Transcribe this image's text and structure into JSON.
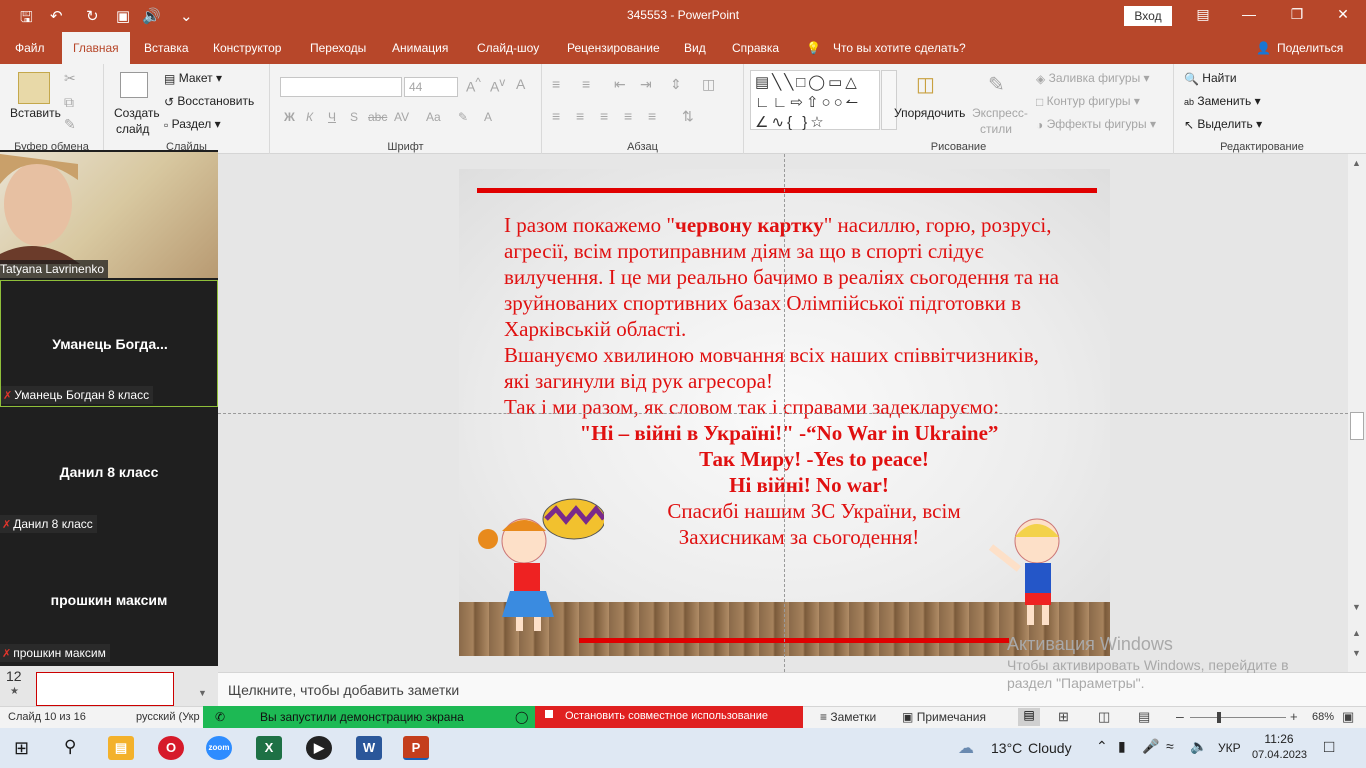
{
  "window": {
    "title": "345553  -  PowerPoint",
    "signin": "Вход"
  },
  "tabs": [
    "Файл",
    "Главная",
    "Вставка",
    "Конструктор",
    "Переходы",
    "Анимация",
    "Слайд-шоу",
    "Рецензирование",
    "Вид",
    "Справка"
  ],
  "tell_me": "Что вы хотите сделать?",
  "share_label": "Поделиться",
  "ribbon": {
    "clipboard": {
      "paste": "Вставить",
      "group": "Буфер обмена"
    },
    "slides": {
      "new_slide_1": "Создать",
      "new_slide_2": "слайд",
      "layout": "Макет",
      "reset": "Восстановить",
      "section": "Раздел",
      "group": "Слайды"
    },
    "font": {
      "size": "44",
      "group": "Шрифт",
      "b": "Ж",
      "i": "К",
      "u": "Ч",
      "s": "S",
      "abc": "abc",
      "av": "AV",
      "aa": "Aa",
      "a": "A"
    },
    "paragraph": {
      "group": "Абзац"
    },
    "drawing": {
      "arrange_1": "Упорядочить",
      "styles_1": "Экспресс-",
      "styles_2": "стили",
      "fill": "Заливка фигуры",
      "outline": "Контур фигуры",
      "effects": "Эффекты фигуры",
      "group": "Рисование"
    },
    "editing": {
      "find": "Найти",
      "replace": "Заменить",
      "select": "Выделить",
      "group": "Редактирование"
    }
  },
  "participants": [
    {
      "label": "Tatyana Lavrinenko",
      "name": ""
    },
    {
      "label": "Уманець Богдан 8 класс",
      "name": "Уманець  Богда..."
    },
    {
      "label": "Данил 8 класс",
      "name": "Данил 8 класс"
    },
    {
      "label": "прошкин максим",
      "name": "прошкин максим"
    }
  ],
  "slide": {
    "para1_a": "І разом покажемо \"",
    "para1_bold": "червону картку",
    "para1_b": "\" насиллю, горю, розрусі, агресії, всім протиправним діям за що в спорті слідує вилучення. І це ми реально бачимо в реаліях сьогодення та на зруйнованих спортивних базах Олімпійської підготовки  в Харківській області.",
    "para2": "Вшануємо  хвилиною мовчання всіх наших співвітчизників, які загинули від рук агресора!",
    "para3": "Так і ми разом, як словом так і справами задекларуємо:",
    "line1": "\"Ні – війні в Україні!\" -“No War in Ukraine”",
    "line2": "Так Миру! -Yes to peace!",
    "line3": "Ні війні!  No war!",
    "line4": "Спасибі нашим ЗС України, всім",
    "line5": "Захисникам за сьогодення!"
  },
  "notes_placeholder": "Щелкните, чтобы добавить заметки",
  "thumb": {
    "number": "12",
    "star": "★"
  },
  "status": {
    "slide_info": "Слайд 10 из 16",
    "language": "русский (Укр",
    "screen_share": "Вы запустили демонстрацию экрана",
    "stop_share": "Остановить совместное использование",
    "notes": "Заметки",
    "comments": "Примечания",
    "zoom": "68%"
  },
  "watermark": {
    "title": "Активация Windows",
    "line1": "Чтобы активировать Windows, перейдите в",
    "line2": "раздел \"Параметры\"."
  },
  "taskbar": {
    "weather_temp": "13°C",
    "weather_text": "Cloudy",
    "lang": "УКР",
    "time": "11:26",
    "date": "07.04.2023"
  },
  "colors": {
    "accent": "#b7472a",
    "slide_text": "#e01010",
    "share_green": "#1db954",
    "share_red": "#e02020"
  }
}
